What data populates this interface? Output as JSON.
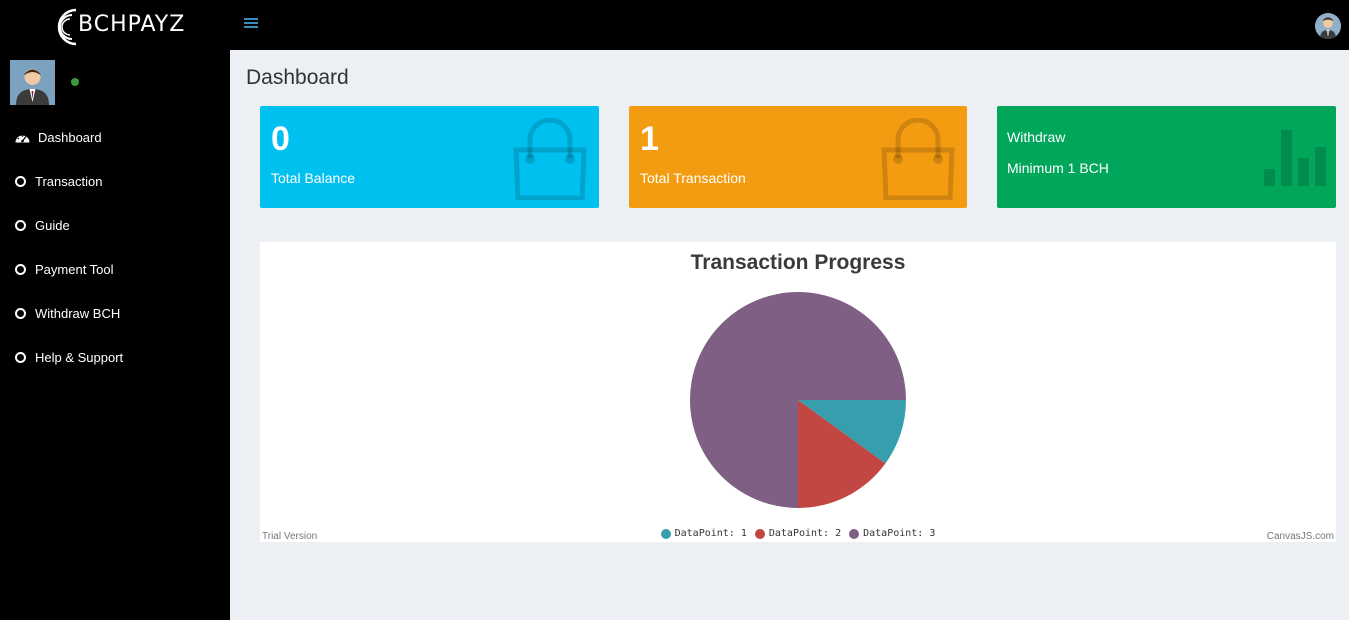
{
  "brand": {
    "name": "BCHPAYZ"
  },
  "sidebar": {
    "items": [
      {
        "label": "Dashboard",
        "icon": "dashboard-icon"
      },
      {
        "label": "Transaction",
        "icon": "circle-icon"
      },
      {
        "label": "Guide",
        "icon": "circle-icon"
      },
      {
        "label": "Payment Tool",
        "icon": "circle-icon"
      },
      {
        "label": "Withdraw BCH",
        "icon": "circle-icon"
      },
      {
        "label": "Help & Support",
        "icon": "circle-icon"
      }
    ]
  },
  "page": {
    "title": "Dashboard"
  },
  "boxes": {
    "balance": {
      "value": "0",
      "label": "Total Balance",
      "color": "#00c0ef"
    },
    "transaction": {
      "value": "1",
      "label": "Total Transaction",
      "color": "#f39c12"
    },
    "withdraw": {
      "title": "Withdraw",
      "subtitle": "Minimum 1 BCH",
      "color": "#00a65a"
    }
  },
  "chart_data": {
    "type": "pie",
    "title": "Transaction Progress",
    "series": [
      {
        "name": "DataPoint: 1",
        "value": 10,
        "color": "#369EAD"
      },
      {
        "name": "DataPoint: 2",
        "value": 15,
        "color": "#C24642"
      },
      {
        "name": "DataPoint: 3",
        "value": 75,
        "color": "#7F6084"
      }
    ],
    "legend_position": "bottom",
    "watermark": "Trial Version",
    "credits": "CanvasJS.com"
  }
}
